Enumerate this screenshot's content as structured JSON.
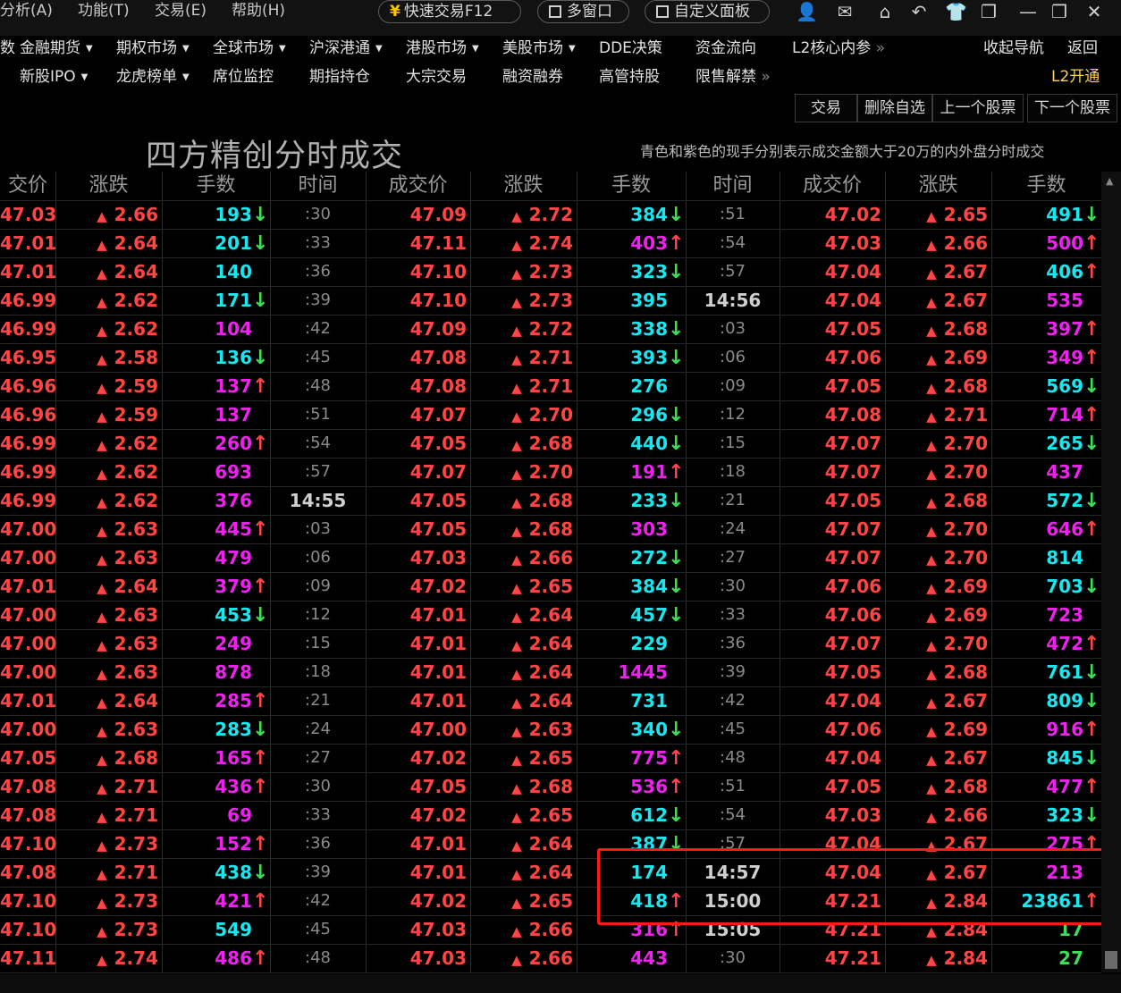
{
  "menu": [
    "分析(A)",
    "功能(T)",
    "交易(E)",
    "帮助(H)"
  ],
  "pills": {
    "quick_trade": "快速交易F12",
    "multi_window": "多窗口",
    "custom_panel": "自定义面板"
  },
  "nav_row1": [
    "金融期货",
    "期权市场",
    "全球市场",
    "沪深港通",
    "港股市场",
    "美股市场",
    "DDE决策",
    "资金流向",
    "L2核心内参"
  ],
  "nav_row1_prefix": "数",
  "nav_row2": [
    "新股IPO",
    "龙虎榜单",
    "席位监控",
    "期指持仓",
    "大宗交易",
    "融资融券",
    "高管持股",
    "限售解禁"
  ],
  "nav_right": {
    "collapse": "收起导航",
    "back": "返回",
    "l2_open": "L2开通"
  },
  "toolbar": [
    "交易",
    "删除自选",
    "上一个股票",
    "下一个股票"
  ],
  "title": "四方精创分时成交",
  "subtitle": "青色和紫色的现手分别表示成交金额大于20万的内外盘分时成交",
  "headers": [
    "交价",
    "涨跌",
    "手数",
    "时间",
    "成交价",
    "涨跌",
    "手数",
    "时间",
    "成交价",
    "涨跌",
    "手数"
  ],
  "colors": {
    "red": "#ff4545",
    "cyan": "#19e6ef",
    "magenta": "#ee22ee",
    "green": "#3ddf5a",
    "highlight": "#ff1a1a"
  },
  "col1": [
    [
      "47.03",
      "2.66",
      "193",
      "c",
      "d"
    ],
    [
      "47.01",
      "2.64",
      "201",
      "c",
      "d"
    ],
    [
      "47.01",
      "2.64",
      "140",
      "c",
      ""
    ],
    [
      "46.99",
      "2.62",
      "171",
      "c",
      "d"
    ],
    [
      "46.99",
      "2.62",
      "104",
      "m",
      ""
    ],
    [
      "46.95",
      "2.58",
      "136",
      "c",
      "d"
    ],
    [
      "46.96",
      "2.59",
      "137",
      "m",
      "u"
    ],
    [
      "46.96",
      "2.59",
      "137",
      "m",
      ""
    ],
    [
      "46.99",
      "2.62",
      "260",
      "m",
      "u"
    ],
    [
      "46.99",
      "2.62",
      "693",
      "m",
      ""
    ],
    [
      "46.99",
      "2.62",
      "376",
      "m",
      ""
    ],
    [
      "47.00",
      "2.63",
      "445",
      "m",
      "u"
    ],
    [
      "47.00",
      "2.63",
      "479",
      "m",
      ""
    ],
    [
      "47.01",
      "2.64",
      "379",
      "m",
      "u"
    ],
    [
      "47.00",
      "2.63",
      "453",
      "c",
      "d"
    ],
    [
      "47.00",
      "2.63",
      "249",
      "m",
      ""
    ],
    [
      "47.00",
      "2.63",
      "878",
      "m",
      ""
    ],
    [
      "47.01",
      "2.64",
      "285",
      "m",
      "u"
    ],
    [
      "47.00",
      "2.63",
      "283",
      "c",
      "d"
    ],
    [
      "47.05",
      "2.68",
      "165",
      "m",
      "u"
    ],
    [
      "47.08",
      "2.71",
      "436",
      "m",
      "u"
    ],
    [
      "47.08",
      "2.71",
      "69",
      "m",
      ""
    ],
    [
      "47.10",
      "2.73",
      "152",
      "m",
      "u"
    ],
    [
      "47.08",
      "2.71",
      "438",
      "c",
      "d"
    ],
    [
      "47.10",
      "2.73",
      "421",
      "m",
      "u"
    ],
    [
      "47.10",
      "2.73",
      "549",
      "c",
      ""
    ],
    [
      "47.11",
      "2.74",
      "486",
      "m",
      "u"
    ]
  ],
  "time1": [
    ":30",
    ":33",
    ":36",
    ":39",
    ":42",
    ":45",
    ":48",
    ":51",
    ":54",
    ":57",
    "14:55",
    ":03",
    ":06",
    ":09",
    ":12",
    ":15",
    ":18",
    ":21",
    ":24",
    ":27",
    ":30",
    ":33",
    ":36",
    ":39",
    ":42",
    ":45",
    ":48"
  ],
  "col2": [
    [
      "47.09",
      "2.72",
      "384",
      "c",
      "d"
    ],
    [
      "47.11",
      "2.74",
      "403",
      "m",
      "u"
    ],
    [
      "47.10",
      "2.73",
      "323",
      "c",
      "d"
    ],
    [
      "47.10",
      "2.73",
      "395",
      "c",
      ""
    ],
    [
      "47.09",
      "2.72",
      "338",
      "c",
      "d"
    ],
    [
      "47.08",
      "2.71",
      "393",
      "c",
      "d"
    ],
    [
      "47.08",
      "2.71",
      "276",
      "c",
      ""
    ],
    [
      "47.07",
      "2.70",
      "296",
      "c",
      "d"
    ],
    [
      "47.05",
      "2.68",
      "440",
      "c",
      "d"
    ],
    [
      "47.07",
      "2.70",
      "191",
      "m",
      "u"
    ],
    [
      "47.05",
      "2.68",
      "233",
      "c",
      "d"
    ],
    [
      "47.05",
      "2.68",
      "303",
      "m",
      ""
    ],
    [
      "47.03",
      "2.66",
      "272",
      "c",
      "d"
    ],
    [
      "47.02",
      "2.65",
      "384",
      "c",
      "d"
    ],
    [
      "47.01",
      "2.64",
      "457",
      "c",
      "d"
    ],
    [
      "47.01",
      "2.64",
      "229",
      "c",
      ""
    ],
    [
      "47.01",
      "2.64",
      "1445",
      "m",
      ""
    ],
    [
      "47.01",
      "2.64",
      "731",
      "c",
      ""
    ],
    [
      "47.00",
      "2.63",
      "340",
      "c",
      "d"
    ],
    [
      "47.02",
      "2.65",
      "775",
      "m",
      "u"
    ],
    [
      "47.05",
      "2.68",
      "536",
      "m",
      "u"
    ],
    [
      "47.02",
      "2.65",
      "612",
      "c",
      "d"
    ],
    [
      "47.01",
      "2.64",
      "387",
      "c",
      "d"
    ],
    [
      "47.01",
      "2.64",
      "174",
      "c",
      ""
    ],
    [
      "47.02",
      "2.65",
      "418",
      "c",
      "u"
    ],
    [
      "47.03",
      "2.66",
      "316",
      "m",
      "u"
    ],
    [
      "47.03",
      "2.66",
      "443",
      "m",
      ""
    ]
  ],
  "time2": [
    ":51",
    ":54",
    ":57",
    "14:56",
    ":03",
    ":06",
    ":09",
    ":12",
    ":15",
    ":18",
    ":21",
    ":24",
    ":27",
    ":30",
    ":33",
    ":36",
    ":39",
    ":42",
    ":45",
    ":48",
    ":51",
    ":54",
    ":57",
    "14:57",
    "15:00",
    "15:05",
    ":30"
  ],
  "col3": [
    [
      "47.02",
      "2.65",
      "491",
      "c",
      "d"
    ],
    [
      "47.03",
      "2.66",
      "500",
      "m",
      "u"
    ],
    [
      "47.04",
      "2.67",
      "406",
      "c",
      "u"
    ],
    [
      "47.04",
      "2.67",
      "535",
      "m",
      ""
    ],
    [
      "47.05",
      "2.68",
      "397",
      "m",
      "u"
    ],
    [
      "47.06",
      "2.69",
      "349",
      "m",
      "u"
    ],
    [
      "47.05",
      "2.68",
      "569",
      "c",
      "d"
    ],
    [
      "47.08",
      "2.71",
      "714",
      "m",
      "u"
    ],
    [
      "47.07",
      "2.70",
      "265",
      "c",
      "d"
    ],
    [
      "47.07",
      "2.70",
      "437",
      "m",
      ""
    ],
    [
      "47.05",
      "2.68",
      "572",
      "c",
      "d"
    ],
    [
      "47.07",
      "2.70",
      "646",
      "m",
      "u"
    ],
    [
      "47.07",
      "2.70",
      "814",
      "c",
      ""
    ],
    [
      "47.06",
      "2.69",
      "703",
      "c",
      "d"
    ],
    [
      "47.06",
      "2.69",
      "723",
      "m",
      ""
    ],
    [
      "47.07",
      "2.70",
      "472",
      "m",
      "u"
    ],
    [
      "47.05",
      "2.68",
      "761",
      "c",
      "d"
    ],
    [
      "47.04",
      "2.67",
      "809",
      "c",
      "d"
    ],
    [
      "47.06",
      "2.69",
      "916",
      "m",
      "u"
    ],
    [
      "47.04",
      "2.67",
      "845",
      "c",
      "d"
    ],
    [
      "47.05",
      "2.68",
      "477",
      "m",
      "u"
    ],
    [
      "47.03",
      "2.66",
      "323",
      "c",
      "d"
    ],
    [
      "47.04",
      "2.67",
      "275",
      "m",
      "u"
    ],
    [
      "47.04",
      "2.67",
      "213",
      "m",
      ""
    ],
    [
      "47.21",
      "2.84",
      "23861",
      "c",
      "u"
    ],
    [
      "47.21",
      "2.84",
      "17",
      "g",
      ""
    ],
    [
      "47.21",
      "2.84",
      "27",
      "g",
      ""
    ]
  ]
}
